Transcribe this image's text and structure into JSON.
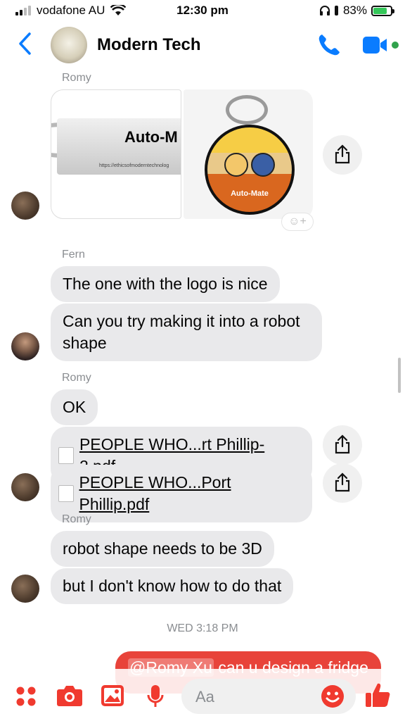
{
  "status_bar": {
    "carrier": "vodafone AU",
    "time": "12:30 pm",
    "battery": "83%"
  },
  "header": {
    "title": "Modern Tech"
  },
  "messages": {
    "romy_1_sender": "Romy",
    "image_tag_text": "Auto-M",
    "image_tag_url": "https://ethicsofmoderntechnolog",
    "image_disc_label": "Auto-Mate",
    "fern_sender": "Fern",
    "fern_1": "The one with the logo is nice",
    "fern_2": "Can you try making it into a robot shape",
    "romy_2_sender": "Romy",
    "romy_ok": "OK",
    "file_1": "PEOPLE WHO...rt Phillip-2.pdf",
    "file_2": "PEOPLE WHO...Port Phillip.pdf",
    "romy_3_sender": "Romy",
    "romy_3a": "robot shape needs to be 3D",
    "romy_3b": "but I don't know how to do that",
    "timestamp": "WED 3:18 PM",
    "outgoing_mention": "@Romy Xu",
    "outgoing_text": " can u design a fridge"
  },
  "composer": {
    "placeholder": "Aa"
  },
  "colors": {
    "accent": "#0a7cff",
    "outgoing": "#e8433a",
    "composer_icons": "#f03a2f"
  }
}
